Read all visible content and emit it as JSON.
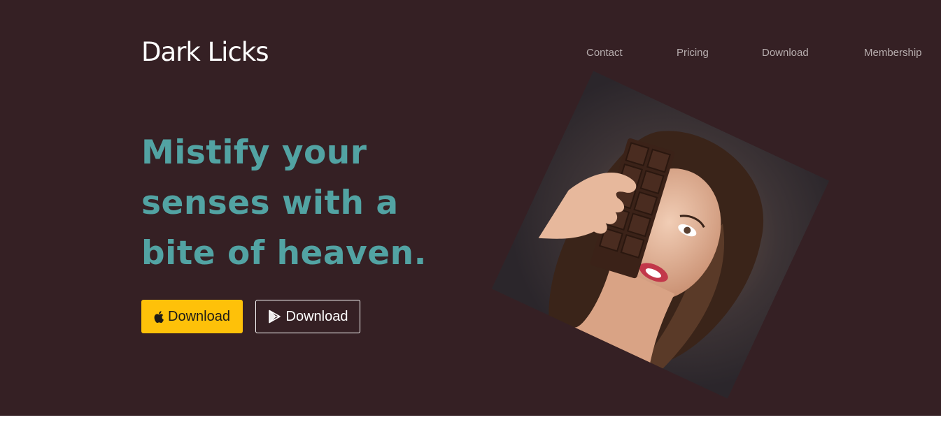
{
  "brand": {
    "name": "Dark Licks"
  },
  "nav": {
    "items": [
      {
        "label": "Contact"
      },
      {
        "label": "Pricing"
      },
      {
        "label": "Download"
      },
      {
        "label": "Membership"
      }
    ]
  },
  "hero": {
    "headline_lines": [
      "Mistify your",
      "senses with a",
      "bite of heaven."
    ],
    "buttons": {
      "app_store": {
        "label": "Download",
        "icon": "apple-icon"
      },
      "google_play": {
        "label": "Download",
        "icon": "google-play-icon"
      }
    },
    "image": {
      "alt": "Woman holding a chocolate bar"
    }
  },
  "colors": {
    "background": "#352024",
    "headline": "#52a3a3",
    "primary_button": "#fec109",
    "nav_text": "#b7adae"
  }
}
